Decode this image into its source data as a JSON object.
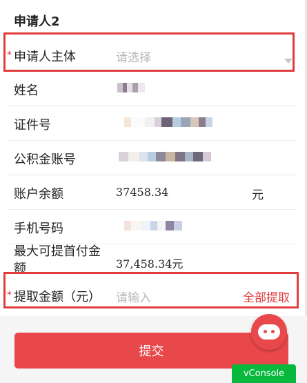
{
  "section": {
    "title": "申请人2"
  },
  "fields": {
    "applicant_type": {
      "label": "申请人主体",
      "placeholder": "请选择"
    },
    "name": {
      "label": "姓名"
    },
    "id_number": {
      "label": "证件号"
    },
    "fund_account": {
      "label": "公积金账号"
    },
    "balance": {
      "label": "账户余额",
      "value": "37458.34",
      "unit": "元"
    },
    "phone": {
      "label": "手机号码"
    },
    "max_down_payment": {
      "label": "最大可提首付金额",
      "value": "37,458.34元"
    },
    "withdraw_amount": {
      "label": "提取金额（元）",
      "placeholder": "请输入",
      "action": "全部提取"
    }
  },
  "submit": {
    "label": "提交"
  },
  "vconsole": {
    "label": "vConsole"
  },
  "colors": {
    "accent": "#e8484a",
    "required": "#e33b3b",
    "vconsole": "#07b83c"
  }
}
